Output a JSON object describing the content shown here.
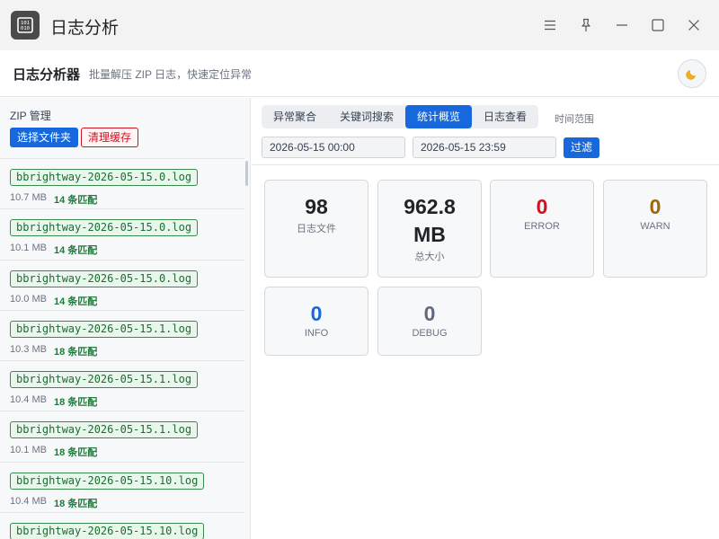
{
  "window": {
    "title": "日志分析",
    "app_icon": "binary-chip-icon",
    "controls": [
      "menu-icon",
      "pin-icon",
      "minimize-icon",
      "maximize-icon",
      "close-icon"
    ]
  },
  "header": {
    "title": "日志分析器",
    "subtitle": "批量解压 ZIP 日志，快速定位异常",
    "theme_icon": "moon-icon"
  },
  "sidebar": {
    "title": "ZIP 管理",
    "select_folder_label": "选择文件夹",
    "clear_cache_label": "清理缓存",
    "files": [
      {
        "name": "bbrightway-2026-05-15.0.log",
        "size": "10.7 MB",
        "matches": "14 条匹配"
      },
      {
        "name": "bbrightway-2026-05-15.0.log",
        "size": "10.1 MB",
        "matches": "14 条匹配"
      },
      {
        "name": "bbrightway-2026-05-15.0.log",
        "size": "10.0 MB",
        "matches": "14 条匹配"
      },
      {
        "name": "bbrightway-2026-05-15.1.log",
        "size": "10.3 MB",
        "matches": "18 条匹配"
      },
      {
        "name": "bbrightway-2026-05-15.1.log",
        "size": "10.4 MB",
        "matches": "18 条匹配"
      },
      {
        "name": "bbrightway-2026-05-15.1.log",
        "size": "10.1 MB",
        "matches": "18 条匹配"
      },
      {
        "name": "bbrightway-2026-05-15.10.log",
        "size": "10.4 MB",
        "matches": "18 条匹配"
      },
      {
        "name": "bbrightway-2026-05-15.10.log",
        "size": "",
        "matches": ""
      }
    ]
  },
  "main": {
    "tabs": [
      {
        "label": "异常聚合",
        "active": false
      },
      {
        "label": "关键词搜索",
        "active": false
      },
      {
        "label": "统计概览",
        "active": true
      },
      {
        "label": "日志查看",
        "active": false
      }
    ],
    "time_range_label": "时间范围",
    "start_time": "2026-05-15 00:00",
    "end_time": "2026-05-15 23:59",
    "filter_label": "过滤",
    "stats": [
      {
        "value": "98",
        "label": "日志文件",
        "color": "#1f2328"
      },
      {
        "value": "962.8 MB",
        "label": "总大小",
        "color": "#1f2328"
      },
      {
        "value": "0",
        "label": "ERROR",
        "color": "#cf1322"
      },
      {
        "value": "0",
        "label": "WARN",
        "color": "#a0640c"
      },
      {
        "value": "0",
        "label": "INFO",
        "color": "#1668dc"
      },
      {
        "value": "0",
        "label": "DEBUG",
        "color": "#5f6b7a"
      }
    ]
  }
}
